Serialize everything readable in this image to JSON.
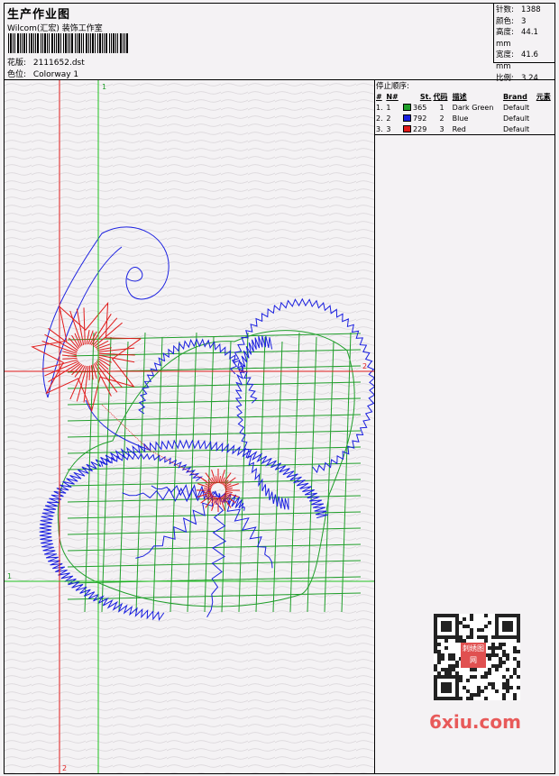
{
  "header": {
    "title": "生产作业图",
    "company": "Wilcom(汇宏) 装饰工作室",
    "design_label": "花版:",
    "design_value": "2111652.dst",
    "colorway_label": "色位:",
    "colorway_value": "Colorway 1"
  },
  "stats": [
    {
      "label": "针数:",
      "value": "1388"
    },
    {
      "label": "颜色:",
      "value": "3"
    },
    {
      "label": "高度:",
      "value": "44.1 mm"
    },
    {
      "label": "宽度:",
      "value": "41.6 mm"
    },
    {
      "label": "比例:",
      "value": "3.24"
    }
  ],
  "guides": {
    "top_marker": "1",
    "right_marker": "2",
    "left_marker": "1",
    "bottom_marker": "2"
  },
  "stop_sequence": {
    "title": "停止顺序:",
    "columns": [
      "#",
      "N#",
      "St.",
      "代码",
      "描述",
      "Brand",
      "元素"
    ],
    "rows": [
      {
        "idx": "1.",
        "n": "1",
        "color": "#1f9e2a",
        "st": "365",
        "code": "1",
        "desc": "Dark Green",
        "brand": "Default"
      },
      {
        "idx": "2.",
        "n": "2",
        "color": "#1a1fe0",
        "st": "792",
        "code": "2",
        "desc": "Blue",
        "brand": "Default"
      },
      {
        "idx": "3.",
        "n": "3",
        "color": "#e01a1a",
        "st": "229",
        "code": "3",
        "desc": "Red",
        "brand": "Default"
      }
    ]
  },
  "watermark": {
    "text": "6xiu.com",
    "seal_text": "刺绣图网"
  },
  "colors": {
    "green": "#1f9e2a",
    "blue": "#1a1fe0",
    "red": "#e01a1a"
  }
}
